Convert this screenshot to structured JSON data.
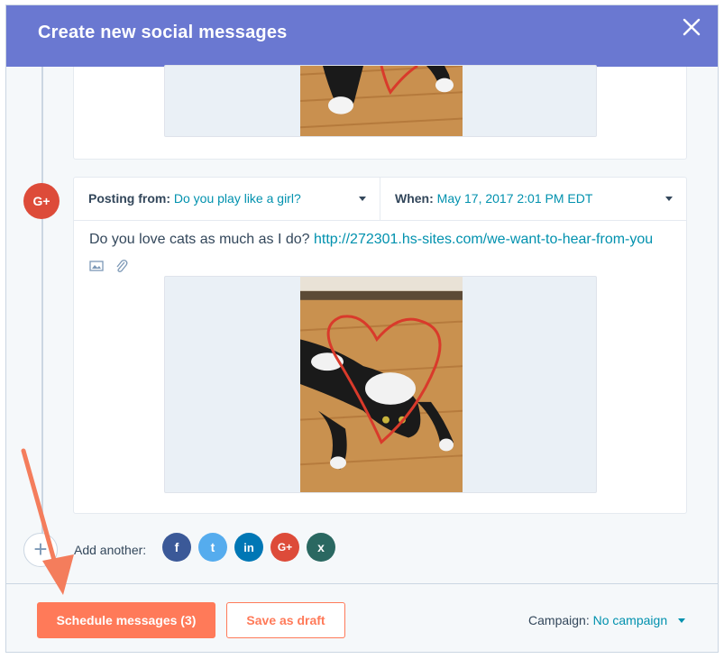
{
  "modal": {
    "title": "Create new social messages"
  },
  "post": {
    "posting_from_label": "Posting from:",
    "posting_from_value": "Do you play like a girl?",
    "when_label": "When:",
    "when_value": "May 17, 2017 2:01 PM EDT",
    "text_plain": "Do you love cats as much as I do? ",
    "text_link": "http://272301.hs-sites.com/we-want-to-hear-from-you",
    "network_badge": "G+"
  },
  "add_another": {
    "plus": "+",
    "label": "Add another:",
    "networks": [
      {
        "name": "facebook",
        "glyph": "f",
        "color": "#3b5998"
      },
      {
        "name": "twitter",
        "glyph": "t",
        "color": "#55acee"
      },
      {
        "name": "linkedin",
        "glyph": "in",
        "color": "#0077b5"
      },
      {
        "name": "google-plus",
        "glyph": "G+",
        "color": "#dd4b39"
      },
      {
        "name": "xing",
        "glyph": "x",
        "color": "#2a6861"
      }
    ]
  },
  "footer": {
    "schedule_label": "Schedule messages (3)",
    "draft_label": "Save as draft",
    "campaign_label": "Campaign:",
    "campaign_value": "No campaign"
  },
  "colors": {
    "header": "#6a78d1",
    "accent": "#ff7a59",
    "link": "#0091ae",
    "annotation_arrow": "#f47d5c"
  }
}
